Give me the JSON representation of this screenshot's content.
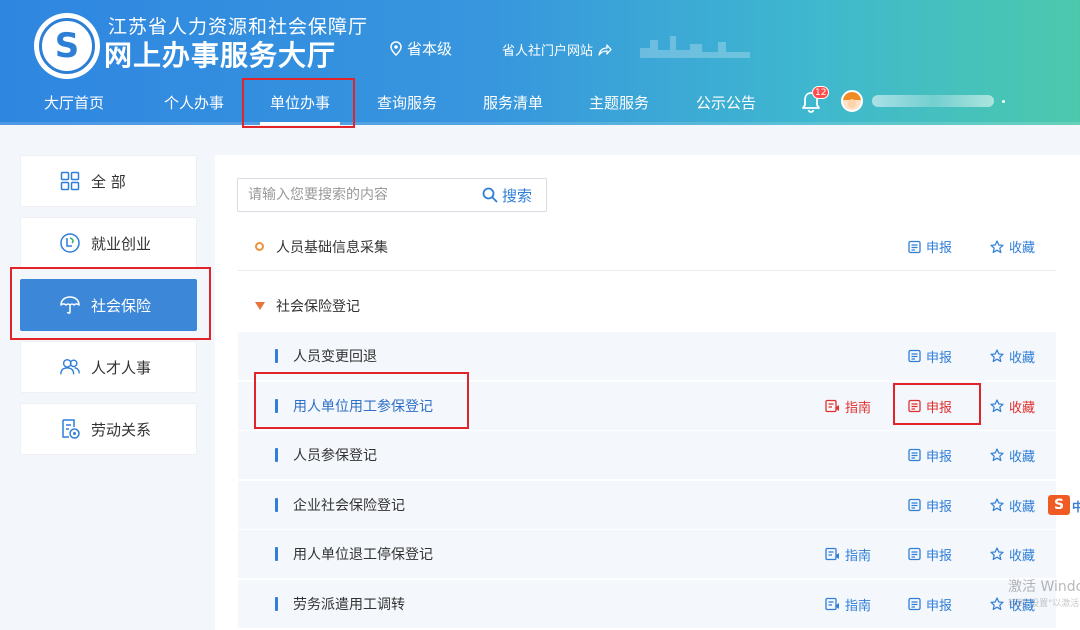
{
  "header": {
    "org_name": "江苏省人力资源和社会保障厅",
    "hall_name": "网上办事服务大厅",
    "level": "省本级",
    "portal_link": "省人社门户网站",
    "notification_count": "12"
  },
  "nav": {
    "items": [
      {
        "label": "大厅首页",
        "active": false
      },
      {
        "label": "个人办事",
        "active": false
      },
      {
        "label": "单位办事",
        "active": true
      },
      {
        "label": "查询服务",
        "active": false
      },
      {
        "label": "服务清单",
        "active": false
      },
      {
        "label": "主题服务",
        "active": false
      },
      {
        "label": "公示公告",
        "active": false
      }
    ]
  },
  "sidebar": {
    "items": [
      {
        "label": "全 部",
        "icon": "grid-icon",
        "active": false
      },
      {
        "label": "就业创业",
        "icon": "employment-icon",
        "active": false
      },
      {
        "label": "社会保险",
        "icon": "umbrella-icon",
        "active": true
      },
      {
        "label": "人才人事",
        "icon": "people-icon",
        "active": false
      },
      {
        "label": "劳动关系",
        "icon": "document-icon",
        "active": false
      }
    ]
  },
  "search": {
    "placeholder": "请输入您要搜索的内容",
    "value": "",
    "button_label": "搜索"
  },
  "actions": {
    "guide": "指南",
    "declare": "申报",
    "favorite": "收藏"
  },
  "list": {
    "groups": [
      {
        "title": "人员基础信息采集"
      },
      {
        "title": "社会保险登记"
      }
    ],
    "sub_items": [
      {
        "title": "人员变更回退",
        "has_guide": false,
        "highlighted": false
      },
      {
        "title": "用人单位用工参保登记",
        "has_guide": true,
        "highlighted": true
      },
      {
        "title": "人员参保登记",
        "has_guide": false,
        "highlighted": false
      },
      {
        "title": "企业社会保险登记",
        "has_guide": false,
        "highlighted": false
      },
      {
        "title": "用人单位退工停保登记",
        "has_guide": true,
        "highlighted": false
      },
      {
        "title": "劳务派遣用工调转",
        "has_guide": true,
        "highlighted": false
      }
    ]
  },
  "watermark": {
    "line1": "激活 Windows",
    "line2": "转到\"设置\"以激活"
  },
  "colors": {
    "primary": "#2f7ed8",
    "highlight_red": "#e0242a",
    "active_sidebar": "#3d87d9"
  }
}
